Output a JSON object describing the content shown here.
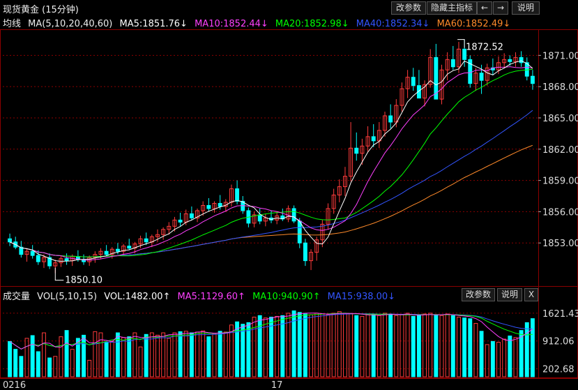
{
  "window": {
    "title": "现货黄金 (15分钟)",
    "buttons": {
      "params": "改参数",
      "hide_indicator": "隐藏主指标",
      "left": "←",
      "right": "→",
      "help": "说明"
    }
  },
  "main_legend": {
    "label": "均线",
    "ma_params": "MA(5,10,20,40,60)",
    "ma5": "MA5:1851.76↓",
    "ma10": "MA10:1852.44↓",
    "ma20": "MA20:1852.98↓",
    "ma40": "MA40:1852.34↓",
    "ma60": "MA60:1852.49↓"
  },
  "volume_legend": {
    "label": "成交量",
    "vol_params": "VOL(5,10,15)",
    "vol": "VOL:1482.00↑",
    "ma5": "MA5:1129.60↑",
    "ma10": "MA10:940.90↑",
    "ma15": "MA15:938.00↓",
    "buttons": {
      "params": "改参数",
      "help": "说明",
      "close": "X"
    }
  },
  "colors": {
    "up": "#ff3b3b",
    "down": "#00ffff",
    "ma5": "#ffffff",
    "ma10": "#ff40ff",
    "ma20": "#00ff00",
    "ma40": "#3355ff",
    "ma60": "#ff8a2a",
    "grid": "#8b0000"
  },
  "chart_data": [
    {
      "type": "candlestick",
      "title": "现货黄金 (15分钟)",
      "ylim": [
        1849.0,
        1873.5
      ],
      "y_ticks": [
        "1871.00",
        "1868.00",
        "1865.00",
        "1862.00",
        "1859.00",
        "1856.00",
        "1853.00"
      ],
      "annotations": [
        {
          "label": "1872.52",
          "value": 1872.52
        },
        {
          "label": "1850.10",
          "value": 1850.1
        }
      ],
      "candles": [
        [
          1853.4,
          1853.9,
          1852.7,
          1853.1
        ],
        [
          1853.1,
          1853.6,
          1852.4,
          1852.6
        ],
        [
          1852.6,
          1853.2,
          1851.6,
          1851.9
        ],
        [
          1851.9,
          1852.5,
          1851.2,
          1852.2
        ],
        [
          1852.2,
          1852.8,
          1851.5,
          1851.8
        ],
        [
          1851.8,
          1852.3,
          1850.9,
          1851.2
        ],
        [
          1851.2,
          1851.9,
          1850.6,
          1851.6
        ],
        [
          1851.6,
          1852.0,
          1850.5,
          1850.8
        ],
        [
          1850.8,
          1851.4,
          1850.1,
          1851.1
        ],
        [
          1851.1,
          1851.8,
          1850.7,
          1851.5
        ],
        [
          1851.5,
          1852.0,
          1850.9,
          1851.3
        ],
        [
          1851.3,
          1851.9,
          1850.8,
          1851.7
        ],
        [
          1851.7,
          1852.3,
          1851.2,
          1851.4
        ],
        [
          1851.4,
          1851.9,
          1850.9,
          1851.2
        ],
        [
          1851.2,
          1851.8,
          1850.8,
          1851.6
        ],
        [
          1851.6,
          1852.2,
          1851.1,
          1851.9
        ],
        [
          1851.9,
          1852.5,
          1851.5,
          1852.2
        ],
        [
          1852.2,
          1852.8,
          1851.7,
          1851.9
        ],
        [
          1851.9,
          1852.6,
          1851.5,
          1852.4
        ],
        [
          1852.4,
          1853.0,
          1851.9,
          1852.2
        ],
        [
          1852.2,
          1852.9,
          1851.8,
          1852.7
        ],
        [
          1852.7,
          1853.4,
          1852.3,
          1852.5
        ],
        [
          1852.5,
          1853.1,
          1852.0,
          1852.9
        ],
        [
          1852.9,
          1853.7,
          1852.5,
          1853.4
        ],
        [
          1853.4,
          1854.0,
          1852.8,
          1853.1
        ],
        [
          1853.1,
          1853.8,
          1852.6,
          1853.6
        ],
        [
          1853.6,
          1854.3,
          1853.1,
          1853.8
        ],
        [
          1853.8,
          1854.5,
          1853.3,
          1854.3
        ],
        [
          1854.3,
          1855.0,
          1853.8,
          1854.6
        ],
        [
          1854.6,
          1855.5,
          1854.1,
          1855.2
        ],
        [
          1855.2,
          1855.9,
          1854.6,
          1855.0
        ],
        [
          1855.0,
          1856.2,
          1854.7,
          1855.8
        ],
        [
          1855.8,
          1856.5,
          1855.2,
          1855.4
        ],
        [
          1855.4,
          1856.3,
          1855.0,
          1856.1
        ],
        [
          1856.1,
          1857.0,
          1855.6,
          1856.6
        ],
        [
          1856.6,
          1857.3,
          1856.0,
          1856.3
        ],
        [
          1856.3,
          1857.0,
          1855.9,
          1856.8
        ],
        [
          1856.8,
          1857.6,
          1856.2,
          1856.5
        ],
        [
          1856.5,
          1857.2,
          1856.0,
          1856.9
        ],
        [
          1856.9,
          1858.6,
          1856.5,
          1858.2
        ],
        [
          1858.2,
          1859.0,
          1856.7,
          1857.0
        ],
        [
          1857.0,
          1857.5,
          1855.8,
          1856.1
        ],
        [
          1856.1,
          1856.4,
          1854.5,
          1854.9
        ],
        [
          1854.9,
          1856.0,
          1854.5,
          1855.7
        ],
        [
          1855.7,
          1856.3,
          1854.8,
          1855.1
        ],
        [
          1855.1,
          1855.8,
          1854.6,
          1855.4
        ],
        [
          1855.4,
          1856.1,
          1854.9,
          1855.2
        ],
        [
          1855.2,
          1856.0,
          1854.8,
          1855.6
        ],
        [
          1855.6,
          1856.3,
          1855.1,
          1855.3
        ],
        [
          1855.3,
          1856.6,
          1855.0,
          1856.3
        ],
        [
          1856.3,
          1856.6,
          1854.9,
          1855.1
        ],
        [
          1855.1,
          1855.4,
          1852.5,
          1853.0
        ],
        [
          1853.0,
          1853.4,
          1850.8,
          1851.3
        ],
        [
          1851.3,
          1852.4,
          1850.4,
          1852.1
        ],
        [
          1852.1,
          1853.6,
          1851.3,
          1853.3
        ],
        [
          1853.3,
          1855.2,
          1852.6,
          1854.8
        ],
        [
          1854.8,
          1856.8,
          1854.3,
          1856.3
        ],
        [
          1856.3,
          1858.2,
          1855.8,
          1857.6
        ],
        [
          1857.6,
          1859.1,
          1856.9,
          1858.4
        ],
        [
          1858.4,
          1860.3,
          1857.5,
          1859.4
        ],
        [
          1859.4,
          1864.6,
          1858.9,
          1862.1
        ],
        [
          1862.1,
          1863.6,
          1860.9,
          1861.6
        ],
        [
          1861.6,
          1863.0,
          1860.5,
          1862.3
        ],
        [
          1862.3,
          1864.2,
          1861.7,
          1863.2
        ],
        [
          1863.2,
          1864.4,
          1862.2,
          1862.8
        ],
        [
          1862.8,
          1864.6,
          1862.1,
          1863.8
        ],
        [
          1863.8,
          1865.6,
          1863.2,
          1865.2
        ],
        [
          1865.2,
          1866.3,
          1864.0,
          1864.6
        ],
        [
          1864.6,
          1866.8,
          1864.1,
          1866.2
        ],
        [
          1866.2,
          1868.4,
          1865.6,
          1867.8
        ],
        [
          1867.8,
          1869.6,
          1866.9,
          1868.9
        ],
        [
          1868.9,
          1869.8,
          1867.6,
          1868.1
        ],
        [
          1868.1,
          1869.6,
          1867.2,
          1866.9
        ],
        [
          1866.9,
          1868.6,
          1866.1,
          1868.2
        ],
        [
          1868.2,
          1871.6,
          1867.9,
          1870.8
        ],
        [
          1870.8,
          1872.1,
          1868.6,
          1866.8
        ],
        [
          1866.8,
          1870.1,
          1866.3,
          1869.6
        ],
        [
          1869.6,
          1871.3,
          1868.6,
          1870.6
        ],
        [
          1870.6,
          1871.9,
          1869.6,
          1869.9
        ],
        [
          1869.9,
          1872.3,
          1869.3,
          1871.6
        ],
        [
          1871.6,
          1872.5,
          1869.9,
          1870.6
        ],
        [
          1870.6,
          1871.0,
          1867.9,
          1868.3
        ],
        [
          1868.3,
          1869.8,
          1867.6,
          1869.3
        ],
        [
          1869.3,
          1870.1,
          1867.3,
          1868.6
        ],
        [
          1868.6,
          1870.2,
          1868.1,
          1869.8
        ],
        [
          1869.8,
          1870.7,
          1869.1,
          1869.6
        ],
        [
          1869.6,
          1870.9,
          1869.2,
          1870.3
        ],
        [
          1870.3,
          1871.2,
          1869.8,
          1870.6
        ],
        [
          1870.6,
          1871.0,
          1870.0,
          1870.4
        ],
        [
          1870.4,
          1871.3,
          1869.9,
          1870.8
        ],
        [
          1870.8,
          1871.4,
          1869.9,
          1870.3
        ],
        [
          1870.3,
          1870.8,
          1868.6,
          1869.0
        ],
        [
          1869.0,
          1869.6,
          1867.7,
          1868.3
        ]
      ]
    },
    {
      "type": "bar",
      "title": "成交量",
      "ylim": [
        0,
        1850
      ],
      "y_ticks": [
        "1621.43",
        "912.06",
        "202.68"
      ],
      "x_tick_labels": [
        "0216",
        "17"
      ],
      "values": [
        900,
        700,
        520,
        980,
        1050,
        640,
        1120,
        480,
        520,
        1020,
        1180,
        700,
        980,
        1060,
        420,
        1150,
        1120,
        880,
        900,
        1120,
        1000,
        1020,
        1120,
        760,
        1080,
        1120,
        1060,
        1120,
        980,
        1120,
        1150,
        1160,
        1120,
        1140,
        1170,
        1020,
        1100,
        1160,
        1140,
        1320,
        1400,
        1340,
        1380,
        1520,
        1560,
        1500,
        1520,
        1540,
        1560,
        1620,
        1680,
        1640,
        1600,
        1580,
        1620,
        1600,
        1580,
        1620,
        1660,
        1620,
        1600,
        1560,
        1540,
        1580,
        1600,
        1560,
        1620,
        1600,
        1560,
        1580,
        1620,
        1540,
        1560,
        1600,
        1620,
        1580,
        1560,
        1600,
        1560,
        1520,
        1500,
        1480,
        1360,
        1160,
        820,
        900,
        880,
        960,
        1040,
        1000,
        1180,
        1380,
        1482
      ]
    }
  ]
}
